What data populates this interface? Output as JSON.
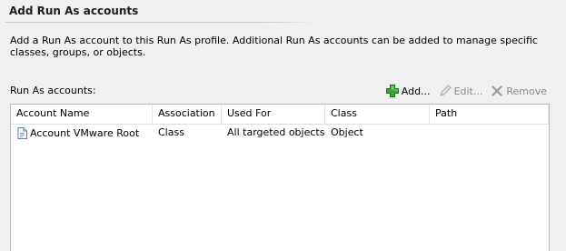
{
  "section": {
    "title": "Add Run As accounts",
    "description": "Add a Run As account to this Run As profile.  Additional Run As accounts can be added to manage specific classes, groups, or objects."
  },
  "accounts": {
    "label": "Run As accounts:",
    "toolbar": {
      "add": "Add...",
      "edit": "Edit...",
      "remove": "Remove"
    },
    "columns": [
      "Account Name",
      "Association",
      "Used For",
      "Class",
      "Path"
    ],
    "rows": [
      [
        "Account VMware Root",
        "Class",
        "All targeted objects",
        "Object",
        ""
      ]
    ]
  },
  "icons": {
    "add": "green-plus-icon",
    "edit": "pencil-icon",
    "remove": "x-icon",
    "row": "document-icon"
  },
  "colors": {
    "add_icon": "#3aa336",
    "disabled_text": "#8a8a8a",
    "grid_border": "#b7bcc4"
  }
}
